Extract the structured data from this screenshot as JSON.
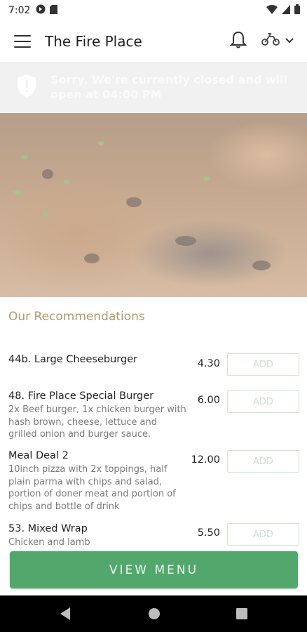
{
  "status_bar": {
    "time": "7:02"
  },
  "app_bar": {
    "title": "The Fire Place"
  },
  "closed_banner": {
    "message": "Sorry, We're currently closed and will open at 04:00 PM"
  },
  "recommendations": {
    "heading": "Our Recommendations",
    "add_label": "ADD",
    "items": [
      {
        "name": "44b. Large Cheeseburger",
        "description": "",
        "price": "4.30"
      },
      {
        "name": "48. Fire Place Special Burger",
        "description": "2x Beef burger, 1x chicken burger with hash brown, cheese, lettuce and grilled onion and burger sauce.",
        "price": "6.00"
      },
      {
        "name": "Meal Deal 2",
        "description": "10inch pizza with 2x toppings, half plain parma with chips and salad, portion of doner meat and portion of chips and bottle of drink",
        "price": "12.00"
      },
      {
        "name": "53. Mixed Wrap",
        "description": "Chicken and lamb",
        "price": "5.50"
      }
    ]
  },
  "view_menu": {
    "label": "VIEW MENU"
  },
  "colors": {
    "accent": "#52a86c",
    "heading": "#b39a6c",
    "banner_bg": "#f1f1f1"
  },
  "icons": {
    "status": [
      "notification-icon",
      "sd-card-icon",
      "wifi-icon",
      "signal-icon",
      "battery-icon"
    ],
    "app_bar": [
      "menu-icon",
      "bell-icon",
      "scooter-icon",
      "chevron-down-icon"
    ],
    "banner": "shield-icon",
    "navigation": [
      "back-icon",
      "home-icon",
      "recents-icon"
    ]
  }
}
